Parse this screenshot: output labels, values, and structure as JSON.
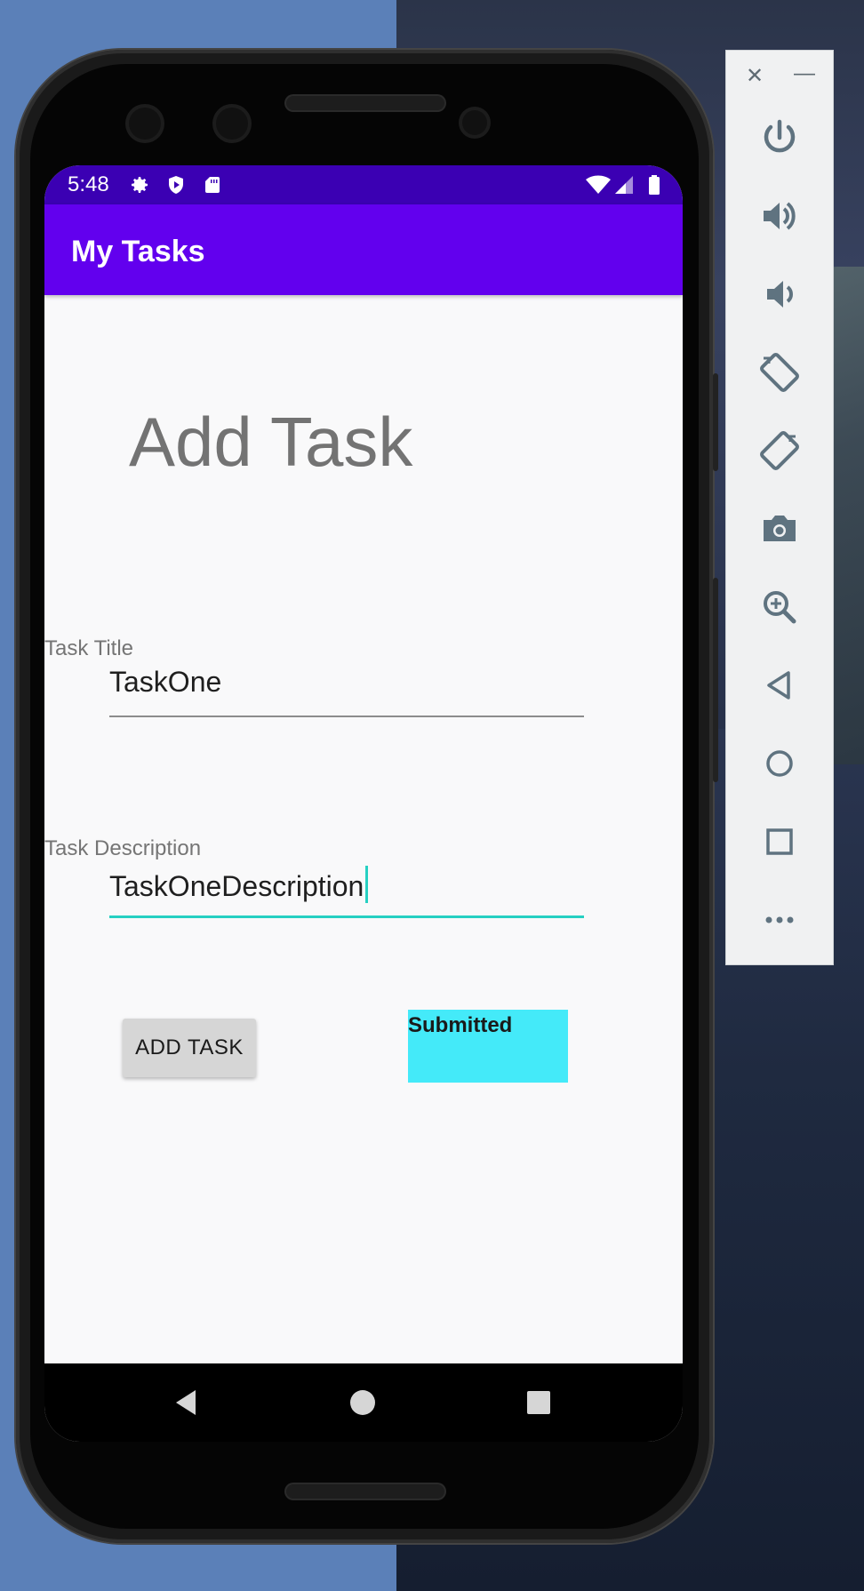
{
  "status_bar": {
    "time": "5:48",
    "icons": [
      "gear-icon",
      "shield-play-icon",
      "sd-card-icon",
      "wifi-icon",
      "signal-icon",
      "battery-icon"
    ]
  },
  "app_bar": {
    "title": "My Tasks"
  },
  "form": {
    "heading": "Add Task",
    "title_label": "Task Title",
    "title_value": "TaskOne",
    "description_label": "Task Description",
    "description_value": "TaskOneDescription",
    "add_button_label": "ADD TASK",
    "submitted_text": "Submitted"
  },
  "nav_bar": {
    "buttons": [
      "back-icon",
      "home-icon",
      "recents-icon"
    ]
  },
  "emulator_panel": {
    "buttons": [
      "close-icon",
      "minimize-icon",
      "power-icon",
      "volume-up-icon",
      "volume-down-icon",
      "rotate-left-icon",
      "rotate-right-icon",
      "camera-icon",
      "zoom-icon",
      "back-icon",
      "home-icon",
      "overview-icon",
      "more-icon"
    ]
  },
  "colors": {
    "status_bar": "#3b00b3",
    "app_bar": "#6200ee",
    "accent": "#26d0c2",
    "submitted_bg": "#44eaf9"
  }
}
